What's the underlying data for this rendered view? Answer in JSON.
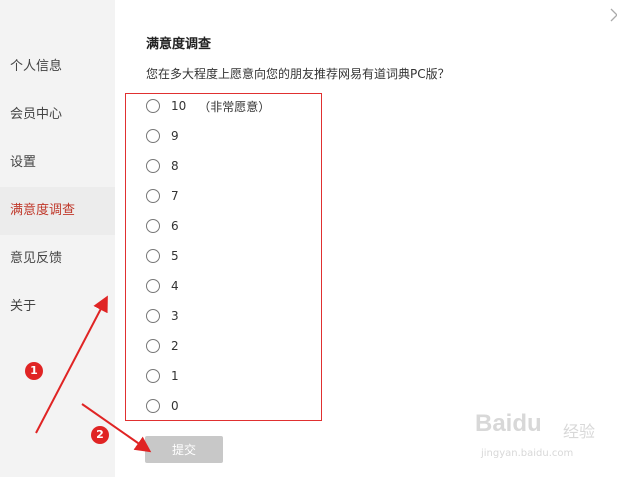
{
  "sidebar": {
    "items": [
      {
        "label": "个人信息"
      },
      {
        "label": "会员中心"
      },
      {
        "label": "设置"
      },
      {
        "label": "满意度调查"
      },
      {
        "label": "意见反馈"
      },
      {
        "label": "关于"
      }
    ],
    "active_index": 3,
    "active_color": "#c0392b"
  },
  "survey": {
    "title": "满意度调查",
    "question": "您在多大程度上愿意向您的朋友推荐网易有道词典PC版？",
    "options": [
      {
        "label": "10",
        "note": "（非常愿意）"
      },
      {
        "label": "9"
      },
      {
        "label": "8"
      },
      {
        "label": "7"
      },
      {
        "label": "6"
      },
      {
        "label": "5"
      },
      {
        "label": "4"
      },
      {
        "label": "3"
      },
      {
        "label": "2"
      },
      {
        "label": "1"
      },
      {
        "label": "0"
      }
    ],
    "submit_label": "提交"
  },
  "annotations": {
    "badge_1": "1",
    "badge_2": "2",
    "color": "#e02424"
  },
  "watermark": {
    "brand": "Baidu",
    "text": "经验",
    "url": "jingyan.baidu.com"
  }
}
